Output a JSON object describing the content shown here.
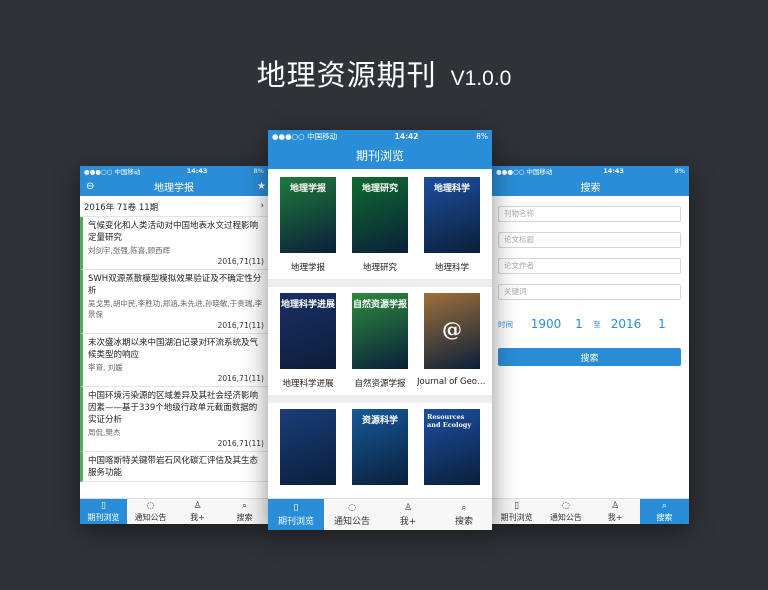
{
  "header": {
    "title": "地理资源期刊",
    "version": "V1.0.0"
  },
  "left": {
    "status": {
      "carrier": "●●●○○ 中国移动",
      "time": "14:43",
      "battery": "8%"
    },
    "nav_title": "地理学报",
    "issue_label": "2016年 71卷 11期",
    "articles": [
      {
        "title": "气候变化和人类活动对中国地表水文过程影响定量研究",
        "authors": "刘剑宇,张强,陈喜,顾西辉",
        "date": "2016,71(11)"
      },
      {
        "title": "SWH双源蒸散模型模拟效果验证及不确定性分析",
        "authors": "吴戈男,胡中民,李胜功,郑涵,朱先进,孙晓敏,于贵瑞,李景保",
        "date": "2016,71(11)"
      },
      {
        "title": "末次盛冰期以来中国湖泊记录对环流系统及气候类型的响应",
        "authors": "李育, 刘媛",
        "date": "2016,71(11)"
      },
      {
        "title": "中国环境污染源的区域差异及其社会经济影响因素——基于339个地级行政单元截面数据的实证分析",
        "authors": "周侃,樊杰",
        "date": "2016,71(11)"
      },
      {
        "title": "中国喀斯特关键带岩石风化碳汇评估及其生态服务功能",
        "authors": "",
        "date": ""
      }
    ],
    "tabs": [
      "期刊浏览",
      "通知公告",
      "我+",
      "搜索"
    ]
  },
  "center": {
    "status": {
      "carrier": "●●●○○ 中国移动",
      "time": "14:42",
      "battery": "8%"
    },
    "nav_title": "期刊浏览",
    "journals": [
      {
        "label": "地理学报",
        "cover_text": "地理学报",
        "color": "#1f7a3a"
      },
      {
        "label": "地理研究",
        "cover_text": "地理研究",
        "color": "#0f6b2e"
      },
      {
        "label": "地理科学",
        "cover_text": "地理科学",
        "color": "#1d4f9e"
      },
      {
        "label": "地理科学进展",
        "cover_text": "地理科学进展",
        "color": "#1b2f66"
      },
      {
        "label": "自然资源学报",
        "cover_text": "自然资源学报",
        "color": "#2e8b3e"
      },
      {
        "label": "Journal of Geog...",
        "cover_text": "@",
        "color": "#a0703a"
      },
      {
        "label": "",
        "cover_text": "",
        "color": "#1a3d7a"
      },
      {
        "label": "",
        "cover_text": "资源科学",
        "color": "#155a9a"
      },
      {
        "label": "",
        "cover_text": "Resources and Ecology",
        "color": "#1c4fa3"
      }
    ],
    "tabs": [
      "期刊浏览",
      "通知公告",
      "我+",
      "搜索"
    ]
  },
  "right": {
    "status": {
      "carrier": "●●●○○ 中国移动",
      "time": "14:43",
      "battery": "8%"
    },
    "nav_title": "搜索",
    "placeholders": [
      "刊物名称",
      "论文标题",
      "论文作者",
      "关键词"
    ],
    "time_label": "时间",
    "year_from": "1900",
    "month_from": "1",
    "to_label": "至",
    "year_to": "2016",
    "month_to": "1",
    "search_button": "搜索",
    "tabs": [
      "期刊浏览",
      "通知公告",
      "我+",
      "搜索"
    ]
  }
}
